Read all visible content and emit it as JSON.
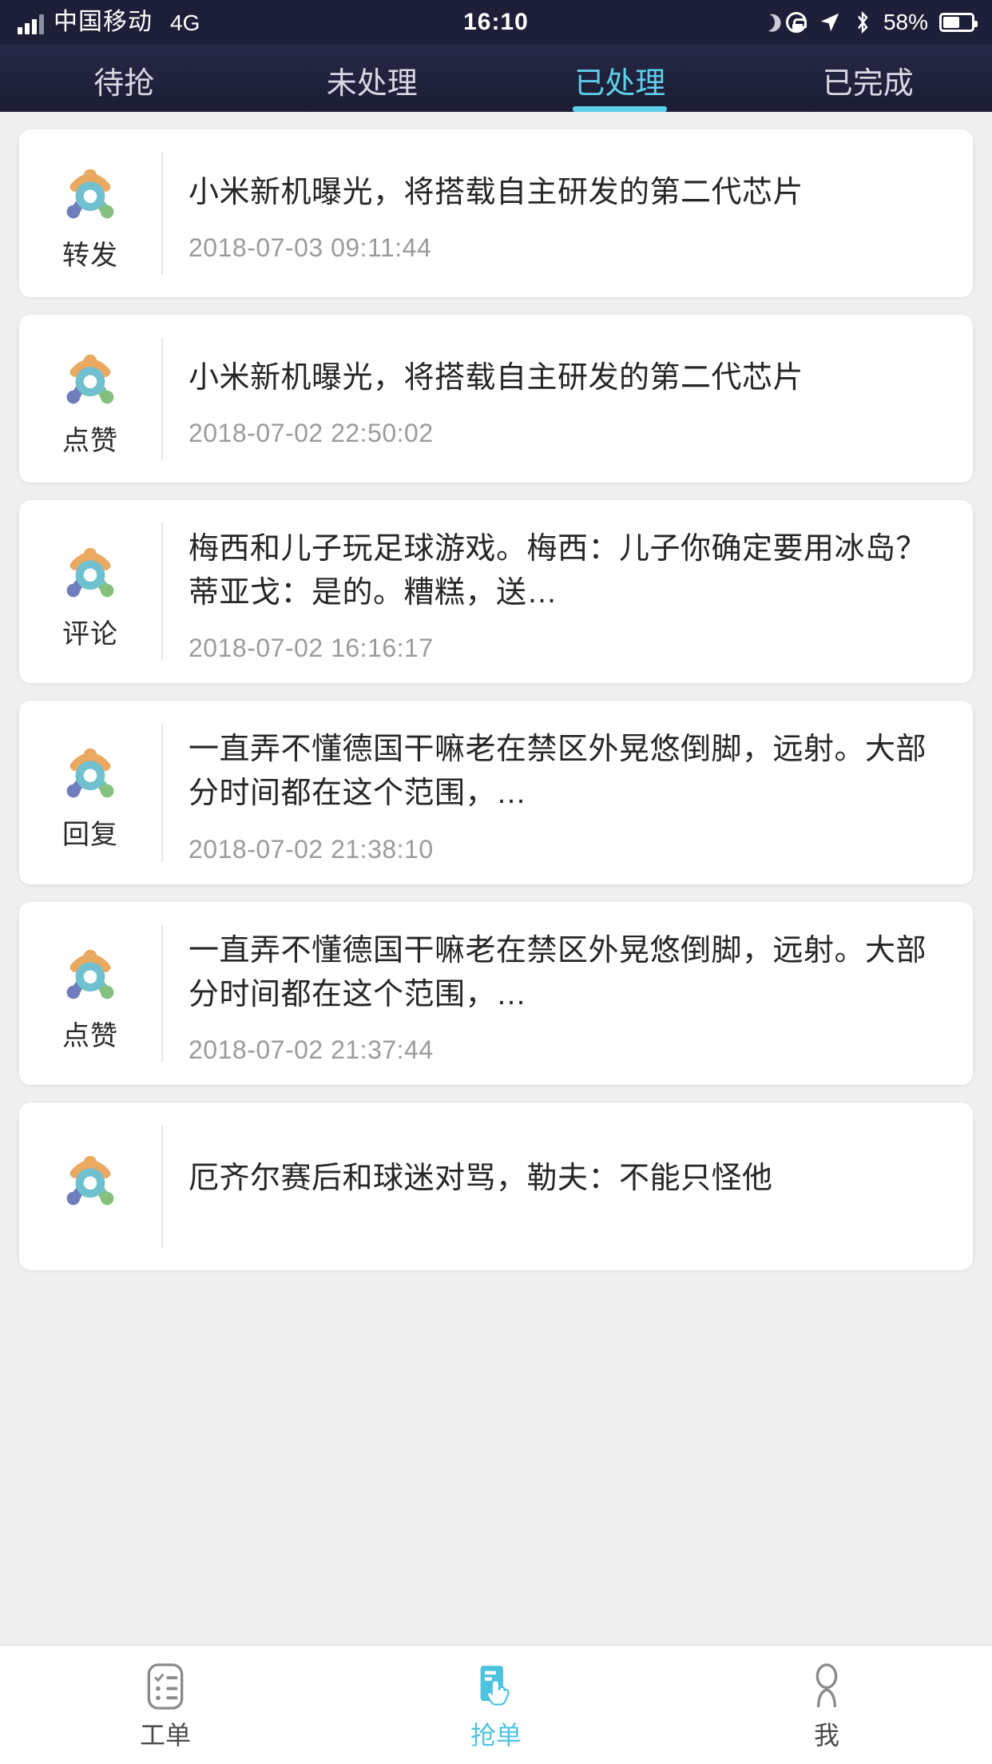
{
  "status_bar": {
    "carrier": "中国移动",
    "network": "4G",
    "time": "16:10",
    "battery_percent": "58%",
    "icons": [
      "signal-icon",
      "moon-icon",
      "rotation-lock-icon",
      "location-icon",
      "bluetooth-icon",
      "battery-icon"
    ]
  },
  "tabs": [
    {
      "label": "待抢",
      "active": false
    },
    {
      "label": "未处理",
      "active": false
    },
    {
      "label": "已处理",
      "active": true
    },
    {
      "label": "已完成",
      "active": false
    }
  ],
  "cards": [
    {
      "type": "转发",
      "title": "小米新机曝光，将搭载自主研发的第二代芯片",
      "time": "2018-07-03 09:11:44"
    },
    {
      "type": "点赞",
      "title": "小米新机曝光，将搭载自主研发的第二代芯片",
      "time": "2018-07-02 22:50:02"
    },
    {
      "type": "评论",
      "title": "梅西和儿子玩足球游戏。梅西：儿子你确定要用冰岛？蒂亚戈：是的。糟糕，送…",
      "time": "2018-07-02 16:16:17"
    },
    {
      "type": "回复",
      "title": "一直弄不懂德国干嘛老在禁区外晃悠倒脚，远射。大部分时间都在这个范围，…",
      "time": "2018-07-02 21:38:10"
    },
    {
      "type": "点赞",
      "title": "一直弄不懂德国干嘛老在禁区外晃悠倒脚，远射。大部分时间都在这个范围，…",
      "time": "2018-07-02 21:37:44"
    },
    {
      "type": "",
      "title": "厄齐尔赛后和球迷对骂，勒夫：不能只怪他",
      "time": ""
    }
  ],
  "bottom_nav": [
    {
      "label": "工单",
      "icon": "checklist-icon",
      "active": false
    },
    {
      "label": "抢单",
      "icon": "tap-card-icon",
      "active": true
    },
    {
      "label": "我",
      "icon": "person-icon",
      "active": false
    }
  ],
  "colors": {
    "accent": "#4ec3e0",
    "header_bg": "#1d1f38",
    "page_bg": "#efefef",
    "card_bg": "#ffffff",
    "muted_text": "#9b9b9b"
  }
}
